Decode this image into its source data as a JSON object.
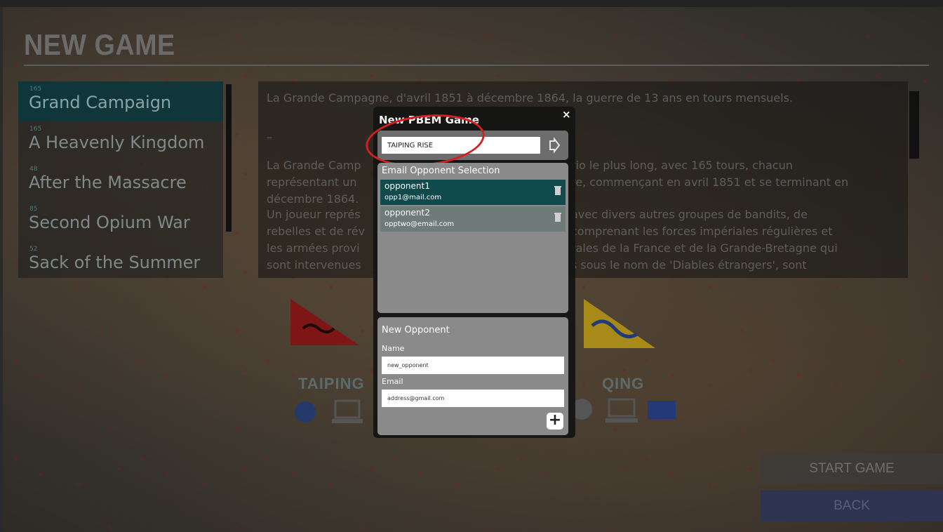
{
  "screen": {
    "title": "NEW GAME"
  },
  "scenarios": [
    {
      "tag": "165",
      "name": "Grand Campaign",
      "selected": true
    },
    {
      "tag": "165",
      "name": "A Heavenly Kingdom",
      "selected": false
    },
    {
      "tag": "48",
      "name": "After the Massacre",
      "selected": false
    },
    {
      "tag": "85",
      "name": "Second Opium War",
      "selected": false
    },
    {
      "tag": "52",
      "name": "Sack of the Summer",
      "selected": false
    }
  ],
  "description": {
    "line1": "La Grande Campagne, d'avril 1851 à décembre 1864, la guerre de 13 ans en tours mensuels.",
    "dash": "–",
    "para_left": [
      "La Grande Camp",
      "représentant un",
      "décembre 1864.",
      "Un joueur représ",
      "rebelles et de rév",
      "les armées provi",
      "sont intervenues"
    ],
    "para_right": [
      "rio le plus long, avec 165 tours, chacun",
      "re, commençant en avril 1851 et se terminant en",
      "",
      "avec divers autres groupes de bandits, de",
      "comprenant les forces impériales régulières et",
      "rales de la France et de la Grande-Bretagne qui",
      "s sous le nom de 'Diables étrangers', sont"
    ]
  },
  "factions": {
    "left": {
      "label": "TAIPING",
      "flag_color": "#8a1a1a"
    },
    "right": {
      "label": "QING",
      "flag_color": "#b8a020"
    }
  },
  "buttons": {
    "start": "START GAME",
    "back": "BACK"
  },
  "modal": {
    "title": "New PBEM Game",
    "close": "×",
    "game_name": "TAIPING RISE",
    "next_icon": "arrow-icon",
    "selection_title": "Email Opponent Selection",
    "opponents": [
      {
        "name": "opponent1",
        "email": "opp1@mail.com",
        "selected": true
      },
      {
        "name": "opponent2",
        "email": "opptwo@email.com",
        "selected": false
      }
    ],
    "new_opponent": {
      "title": "New Opponent",
      "name_label": "Name",
      "name_value": "new_opponent",
      "email_label": "Email",
      "email_value": "address@gmail.com",
      "add": "+"
    }
  },
  "colors": {
    "highlight": "#d21f1f",
    "selected_row": "#114a4c"
  }
}
